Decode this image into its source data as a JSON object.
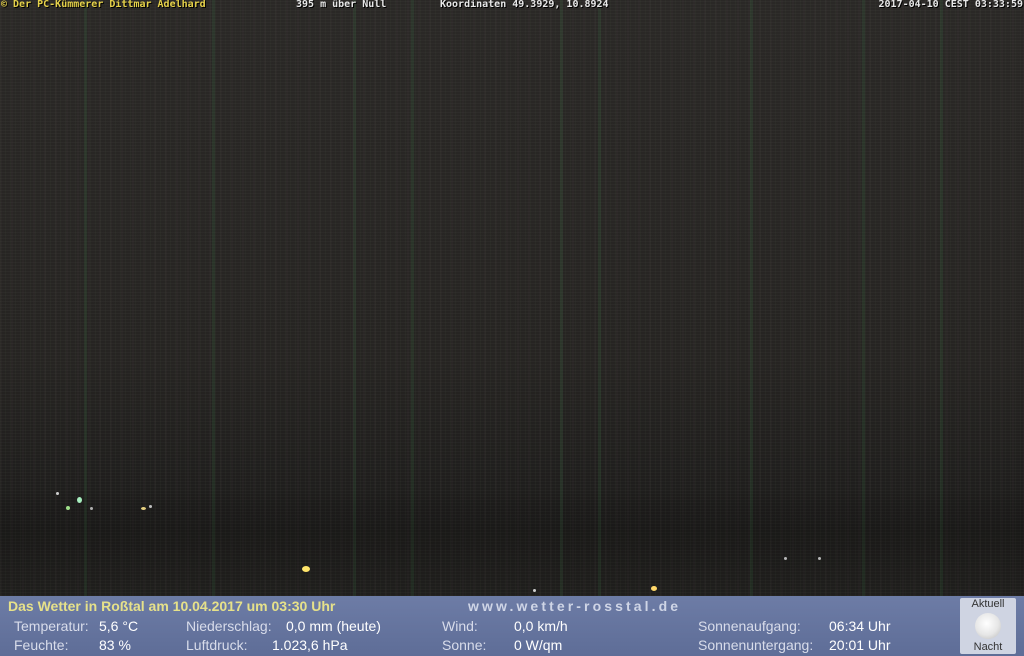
{
  "overlay": {
    "copyright": "© Der PC-Kümmerer Dittmar Adelhard",
    "altitude": "395 m über Null",
    "coordinates": "Koordinaten 49.3929, 10.8924",
    "timestamp": "2017-04-10 CEST 03:33:59"
  },
  "panel": {
    "title": "Das Wetter in Roßtal am 10.04.2017 um 03:30 Uhr",
    "url": "www.wetter-rosstal.de",
    "temperature_label": "Temperatur:",
    "temperature_value": "5,6 °C",
    "humidity_label": "Feuchte:",
    "humidity_value": "83 %",
    "precip_label": "Niederschlag:",
    "precip_value": "0,0 mm (heute)",
    "pressure_label": "Luftdruck:",
    "pressure_value": "1.023,6 hPa",
    "wind_label": "Wind:",
    "wind_value": "0,0 km/h",
    "sun_label": "Sonne:",
    "sun_value": "0 W/qm",
    "sunrise_label": "Sonnenaufgang:",
    "sunrise_value": "06:34 Uhr",
    "sunset_label": "Sonnenuntergang:",
    "sunset_value": "20:01 Uhr",
    "moon_top": "Aktuell",
    "moon_bottom": "Nacht"
  },
  "colors": {
    "overlay_yellow": "#e6d24a",
    "panel_blue": "#6d7ca6",
    "title_yellow": "#e6e18a"
  },
  "icons": {
    "moon": "full-moon-icon"
  }
}
